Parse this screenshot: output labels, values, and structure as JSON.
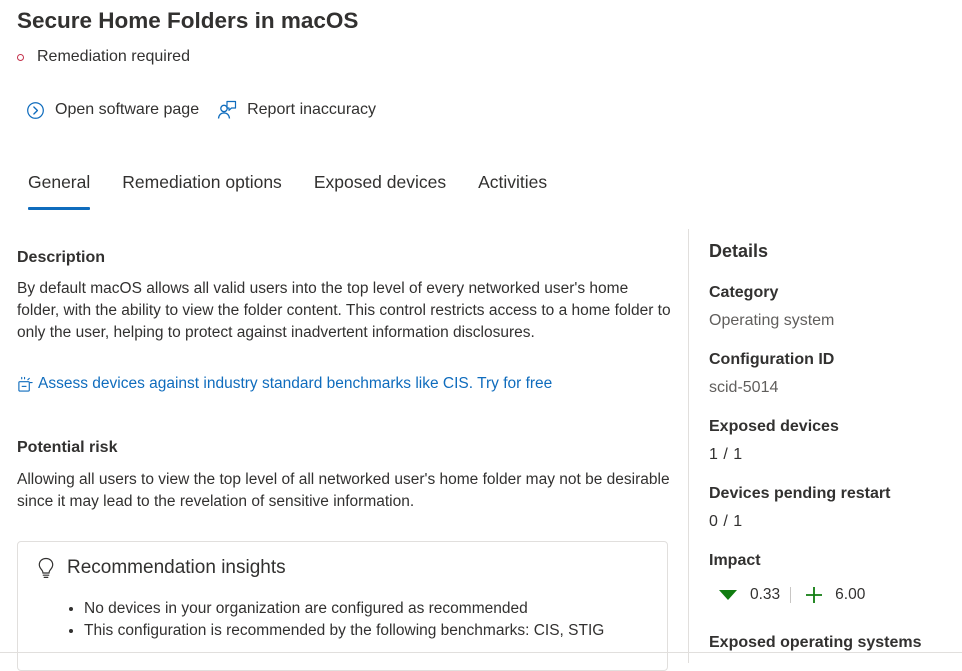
{
  "header": {
    "title": "Secure Home Folders in macOS",
    "status": "Remediation required",
    "status_color": "#c4314b"
  },
  "actions": {
    "open_software": {
      "label": "Open software page",
      "icon": "chevron-right-circle-icon"
    },
    "report": {
      "label": "Report inaccuracy",
      "icon": "person-feedback-icon"
    }
  },
  "tabs": [
    {
      "label": "General",
      "active": true
    },
    {
      "label": "Remediation options",
      "active": false
    },
    {
      "label": "Exposed devices",
      "active": false
    },
    {
      "label": "Activities",
      "active": false
    }
  ],
  "description": {
    "heading": "Description",
    "text": "By default macOS allows all valid users into the top level of every networked user's home folder, with the ability to view the folder content. This control restricts access to a home folder to only the user, helping to protect against inadvertent information disclosures.",
    "link": "Assess devices against industry standard benchmarks like CIS. Try for free",
    "link_color": "#0f6cbd"
  },
  "risk": {
    "heading": "Potential risk",
    "text": "Allowing all users to view the top level of all networked user's home folder may not be desirable since it may lead to the revelation of sensitive information."
  },
  "insights": {
    "title": "Recommendation insights",
    "icon": "lightbulb-icon",
    "items": [
      "No devices in your organization are configured as recommended",
      "This configuration is recommended by the following benchmarks: CIS, STIG"
    ]
  },
  "details": {
    "title": "Details",
    "category_label": "Category",
    "category_value": "Operating system",
    "config_label": "Configuration ID",
    "config_value": "scid-5014",
    "exposed_label": "Exposed devices",
    "exposed_value": "1 / 1",
    "pending_label": "Devices pending restart",
    "pending_value": "0 / 1",
    "impact_label": "Impact",
    "impact_down": "0.33",
    "impact_up": "6.00",
    "impact_down_color": "#107c10",
    "impact_up_color": "#107c10",
    "os_label": "Exposed operating systems"
  }
}
